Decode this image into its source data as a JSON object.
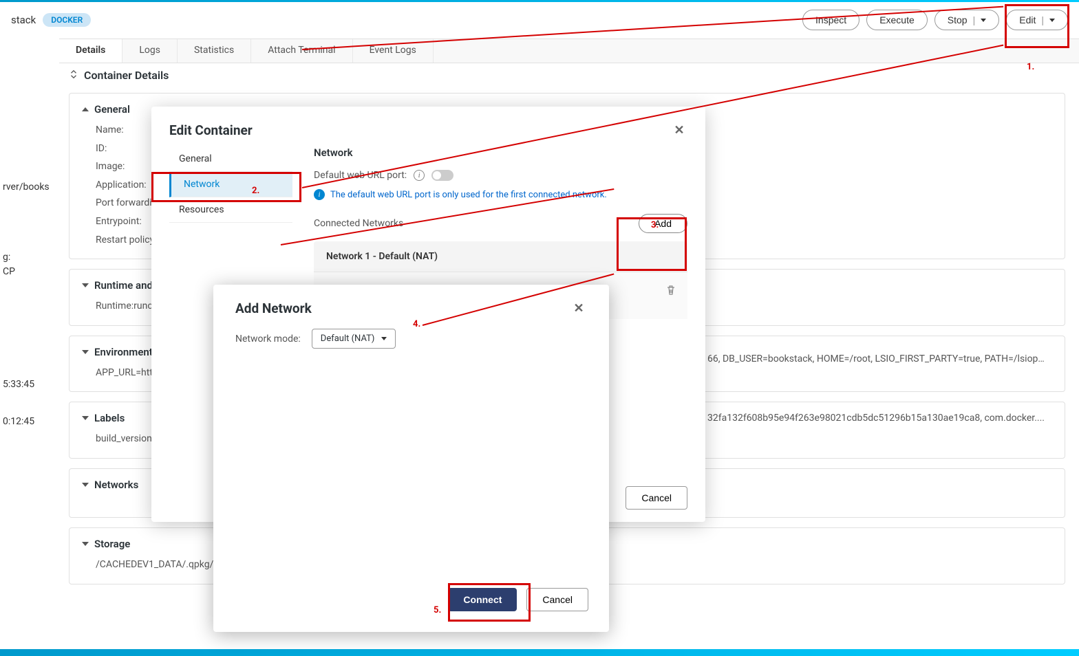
{
  "header": {
    "breadcrumb_stack": "stack",
    "docker_badge": "DOCKER",
    "inspect": "Inspect",
    "execute": "Execute",
    "stop": "Stop",
    "edit": "Edit"
  },
  "tabs": {
    "details": "Details",
    "logs": "Logs",
    "statistics": "Statistics",
    "attach": "Attach Terminal",
    "event_logs": "Event Logs"
  },
  "page_title": "Container Details",
  "general": {
    "heading": "General",
    "name": "Name:",
    "id": "ID:",
    "image": "Image:",
    "application": "Application:",
    "port_forwarding": "Port forwarding:",
    "entrypoint": "Entrypoint:",
    "restart_policy": "Restart policy:"
  },
  "runtime": {
    "heading": "Runtime and Resources",
    "body": "Runtime:runc,"
  },
  "environment": {
    "heading": "Environment",
    "body": "APP_URL=http",
    "overflow": "66, DB_USER=bookstack, HOME=/root, LSIO_FIRST_PARTY=true, PATH=/lsiop…"
  },
  "labels": {
    "heading": "Labels",
    "body": "build_version:",
    "overflow": "32fa132f608b95e94f263e98021cdb5dc51296b15a130ae19ca8, com.docker...."
  },
  "networks": {
    "heading": "Networks"
  },
  "storage": {
    "heading": "Storage",
    "body": "/CACHEDEV1_DATA/.qpkg/"
  },
  "sidebar_hints": {
    "books": "rver/books",
    "g": "g:",
    "cp": "CP",
    "t1": "5:33:45",
    "t2": "0:12:45"
  },
  "edit_modal": {
    "title": "Edit Container",
    "nav_general": "General",
    "nav_network": "Network",
    "nav_resources": "Resources",
    "panel_heading": "Network",
    "default_port_label": "Default web URL port:",
    "info": "The default web URL port is only used for the first connected network.",
    "connected_label": "Connected Networks",
    "add": "Add",
    "network1": "Network 1 - Default (NAT)",
    "cancel": "Cancel"
  },
  "add_modal": {
    "title": "Add Network",
    "mode_label": "Network mode:",
    "mode_value": "Default (NAT)",
    "connect": "Connect",
    "cancel": "Cancel"
  },
  "anno": {
    "n1": "1.",
    "n2": "2.",
    "n3": "3.",
    "n4": "4.",
    "n5": "5."
  }
}
